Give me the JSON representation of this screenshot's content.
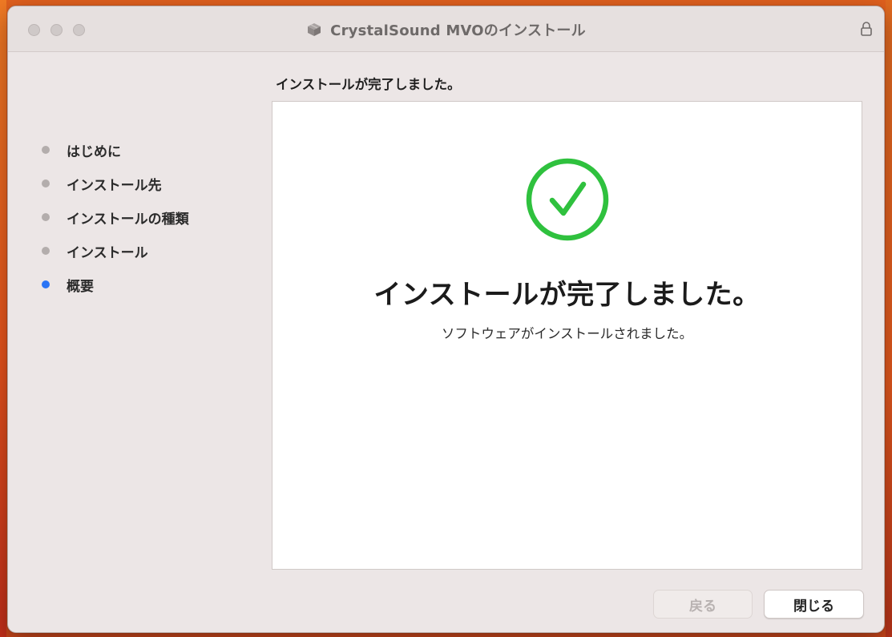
{
  "window": {
    "title": "CrystalSound MVOのインストール"
  },
  "content": {
    "heading": "インストールが完了しました。",
    "done_title": "インストールが完了しました。",
    "done_subtitle": "ソフトウェアがインストールされました。"
  },
  "sidebar": {
    "steps": [
      {
        "label": "はじめに",
        "active": false
      },
      {
        "label": "インストール先",
        "active": false
      },
      {
        "label": "インストールの種類",
        "active": false
      },
      {
        "label": "インストール",
        "active": false
      },
      {
        "label": "概要",
        "active": true
      }
    ]
  },
  "buttons": {
    "back_label": "戻る",
    "close_label": "閉じる"
  },
  "icons": {
    "package": "package-icon",
    "lock": "lock-icon",
    "success": "checkmark-circle-icon"
  },
  "colors": {
    "accent": "#2a74f5",
    "success": "#2fc13e"
  }
}
